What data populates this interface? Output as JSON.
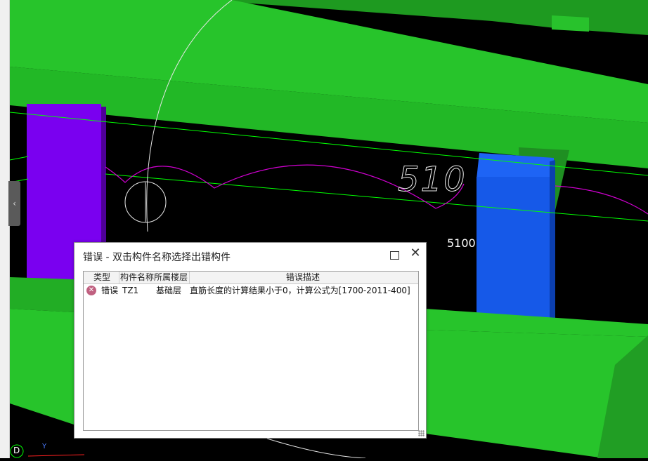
{
  "viewport": {
    "dimension_labels": [
      "510",
      "5100"
    ],
    "axis_labels": {
      "y": "Y",
      "d": "D"
    }
  },
  "dialog": {
    "title": "错误 - 双击构件名称选择出错构件",
    "maximize_icon": "maximize-icon",
    "close_icon": "close-icon",
    "close_glyph": "✕",
    "columns": [
      "类型",
      "构件名称",
      "所属楼层",
      "错误描述"
    ],
    "rows": [
      {
        "type": "错误",
        "name": "TZ1",
        "floor": "基础层",
        "description": "直筋长度的计算结果小于0，计算公式为[1700-2011-400]"
      }
    ]
  },
  "colors": {
    "beam_green": "#26c02a",
    "column_purple": "#7a00f0",
    "column_blue": "#1659e8",
    "rebar_magenta": "#d000d0",
    "axis_green": "#00ff00"
  }
}
